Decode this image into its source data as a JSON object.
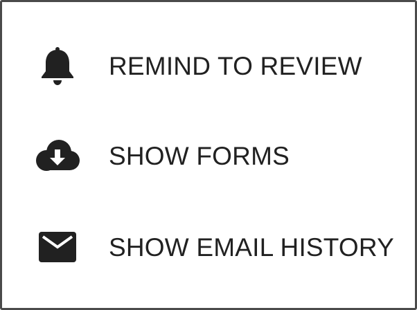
{
  "menu": {
    "items": [
      {
        "label": "REMIND TO REVIEW",
        "icon": "bell-icon"
      },
      {
        "label": "SHOW FORMS",
        "icon": "cloud-download-icon"
      },
      {
        "label": "SHOW EMAIL HISTORY",
        "icon": "email-icon"
      }
    ]
  },
  "colors": {
    "text": "#212121",
    "border": "#4a4a4a",
    "background": "#ffffff"
  }
}
